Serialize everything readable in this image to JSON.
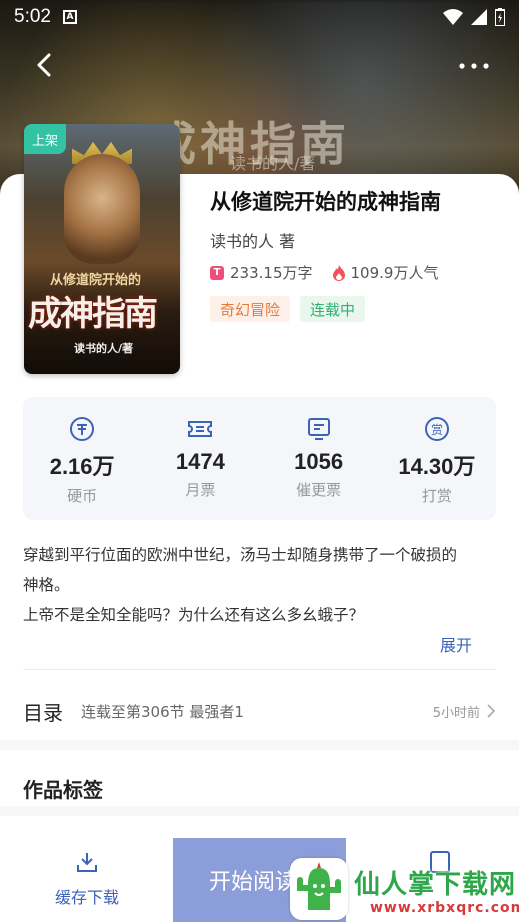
{
  "status_bar": {
    "time": "5:02",
    "notif_letter": "A"
  },
  "banner": {
    "title": "成神指南",
    "subtitle": "读书的人/著"
  },
  "book": {
    "cover_badge": "上架",
    "cover_subtitle": "从修道院开始的",
    "cover_title": "成神指南",
    "cover_author": "读书的人/著",
    "title": "从修道院开始的成神指南",
    "author": "读书的人 著",
    "word_icon": "T",
    "word_count": "233.15万字",
    "popularity": "109.9万人气",
    "tags": [
      "奇幻冒险",
      "连载中"
    ]
  },
  "stats": [
    {
      "icon": "coin-icon",
      "value": "2.16万",
      "label": "硬币"
    },
    {
      "icon": "ticket-icon",
      "value": "1474",
      "label": "月票"
    },
    {
      "icon": "update-icon",
      "value": "1056",
      "label": "催更票"
    },
    {
      "icon": "reward-icon",
      "value": "14.30万",
      "label": "打赏"
    }
  ],
  "description": {
    "line1": "穿越到平行位面的欧洲中世纪，汤马士却随身携带了一个破损的",
    "line2": "神格。",
    "line3": "上帝不是全知全能吗？为什么还有这么多幺蛾子？",
    "expand": "展开"
  },
  "toc": {
    "title": "目录",
    "latest": "连载至第306节 最强者1",
    "time": "5小时前"
  },
  "tags_section": {
    "title": "作品标签"
  },
  "bottom_bar": {
    "download_label": "缓存下载",
    "read_label": "开始阅读"
  },
  "watermark": {
    "text": "仙人掌下载网",
    "url": "www.xrbxqrc.com"
  },
  "colors": {
    "accent": "#3d63b6",
    "read_button": "#8c9ed9",
    "tag_orange": "#e7783d",
    "tag_green": "#30b070",
    "badge": "#33c2a4"
  }
}
